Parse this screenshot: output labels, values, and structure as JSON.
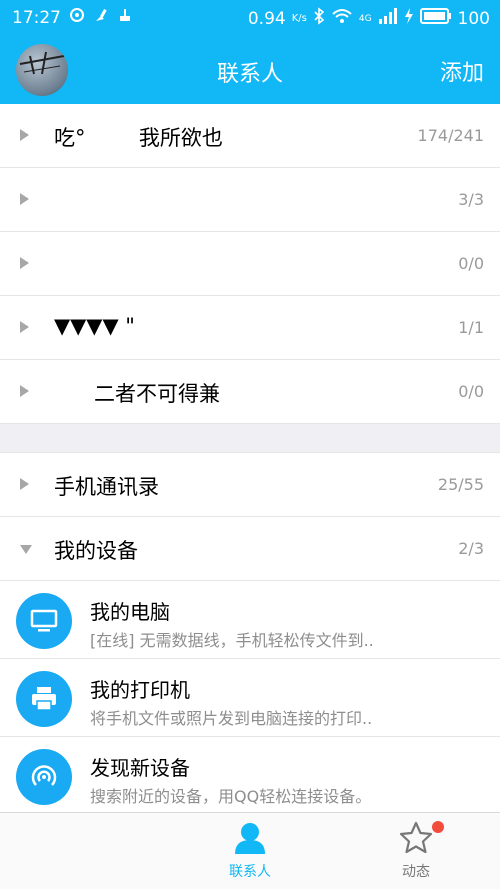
{
  "status_bar": {
    "time": "17:27",
    "network_speed": "0.94",
    "speed_unit": "K/s",
    "network_type": "4G",
    "battery": "100"
  },
  "header": {
    "title": "联系人",
    "add_label": "添加"
  },
  "groups": [
    {
      "name": "吃°        我所欲也",
      "count": "174/241"
    },
    {
      "name": "",
      "count": "3/3"
    },
    {
      "name": "",
      "count": "0/0"
    },
    {
      "name": "▼▼▼▼ \"",
      "count": "1/1"
    },
    {
      "name": "      二者不可得兼",
      "count": "0/0"
    }
  ],
  "special_groups": [
    {
      "name": "手机通讯录",
      "count": "25/55"
    },
    {
      "name": "我的设备",
      "count": "2/3"
    }
  ],
  "devices": [
    {
      "title": "我的电脑",
      "subtitle": "[在线] 无需数据线，手机轻松传文件到..",
      "icon": "monitor-icon"
    },
    {
      "title": "我的打印机",
      "subtitle": "将手机文件或照片发到电脑连接的打印..",
      "icon": "printer-icon"
    },
    {
      "title": "发现新设备",
      "subtitle": "搜索附近的设备，用QQ轻松连接设备。",
      "icon": "radar-icon"
    }
  ],
  "tabs": [
    {
      "label": "联系人",
      "icon": "contacts-icon",
      "active": true
    },
    {
      "label": "动态",
      "icon": "star-icon",
      "active": false
    }
  ],
  "colors": {
    "accent": "#12b7f5",
    "device_icon": "#19aaf3",
    "badge": "#f24c3d"
  }
}
